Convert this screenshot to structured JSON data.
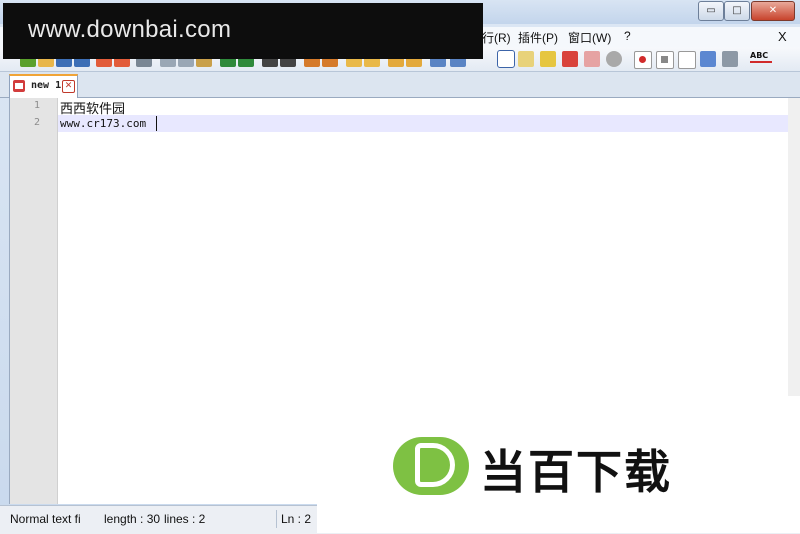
{
  "window": {
    "minimize_glyph": "▭",
    "maximize_glyph": "□",
    "close_glyph": "✕"
  },
  "menu": {
    "items": [
      "行(R)",
      "插件(P)",
      "窗口(W)",
      "?"
    ],
    "close_label": "X"
  },
  "toolbar": {
    "icons": [
      "new-file-icon",
      "open-file-icon",
      "save-icon",
      "save-all-icon",
      "close-icon",
      "close-all-icon",
      "print-icon",
      "cut-icon",
      "copy-icon",
      "paste-icon",
      "undo-icon",
      "redo-icon",
      "find-icon",
      "replace-icon",
      "zoom-in-icon",
      "zoom-out-icon",
      "sync-vertical-icon",
      "sync-horizontal-icon",
      "word-wrap-icon",
      "all-chars-icon",
      "indent-guide-icon",
      "user-language-icon",
      "doc-map-icon",
      "function-list-icon",
      "record-macro-icon",
      "stop-macro-icon",
      "play-macro-icon",
      "run-macro-multiple-icon",
      "save-macro-icon",
      "spellcheck-icon"
    ],
    "spellcheck_label": "ABC"
  },
  "watermark_top": {
    "text": "www.downbai.com"
  },
  "tabs": [
    {
      "label": "new 1",
      "close_glyph": "✕"
    }
  ],
  "editor": {
    "lines": [
      {
        "number": "1",
        "text": "西西软件园"
      },
      {
        "number": "2",
        "text": "www.cr173.com"
      }
    ]
  },
  "status": {
    "file_type": "Normal text fi",
    "length": "length : 30",
    "lines": "lines : 2",
    "position": "Ln : 2"
  },
  "watermark_bottom": {
    "logo_letter": "D",
    "text": "当百下载"
  },
  "colors": {
    "accent_tab": "#f0a437",
    "current_line": "#e8e8ff",
    "logo_green": "#7ec143"
  }
}
